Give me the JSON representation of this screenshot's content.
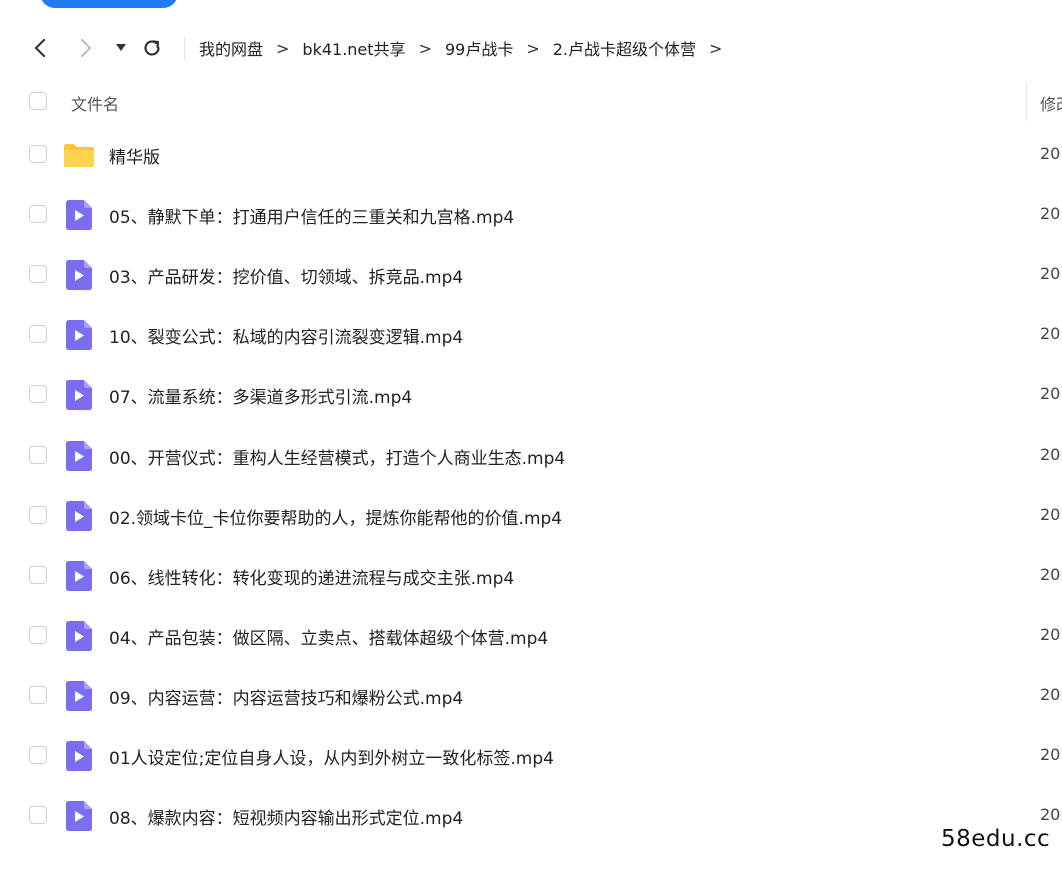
{
  "nav": {
    "breadcrumbs": [
      "我的网盘",
      "bk41.net共享",
      "99卢战卡",
      "2.卢战卡超级个体营"
    ],
    "separator": ">"
  },
  "header": {
    "name_col": "文件名",
    "modified_col": "修改"
  },
  "files": [
    {
      "name": "精华版",
      "type": "folder",
      "date": "20"
    },
    {
      "name": "05、静默下单：打通用户信任的三重关和九宫格.mp4",
      "type": "video",
      "date": "20"
    },
    {
      "name": "03、产品研发：挖价值、切领域、拆竞品.mp4",
      "type": "video",
      "date": "20"
    },
    {
      "name": "10、裂变公式：私域的内容引流裂变逻辑.mp4",
      "type": "video",
      "date": "20"
    },
    {
      "name": "07、流量系统：多渠道多形式引流.mp4",
      "type": "video",
      "date": "20"
    },
    {
      "name": "00、开营仪式：重构人生经营模式，打造个人商业生态.mp4",
      "type": "video",
      "date": "20"
    },
    {
      "name": "02.领域卡位_卡位你要帮助的人，提炼你能帮他的价值.mp4",
      "type": "video",
      "date": "20"
    },
    {
      "name": "06、线性转化：转化变现的递进流程与成交主张.mp4",
      "type": "video",
      "date": "20"
    },
    {
      "name": "04、产品包装：做区隔、立卖点、搭载体超级个体营.mp4",
      "type": "video",
      "date": "20"
    },
    {
      "name": "09、内容运营：内容运营技巧和爆粉公式.mp4",
      "type": "video",
      "date": "20"
    },
    {
      "name": "01人设定位;定位自身人设，从内到外树立一致化标签.mp4",
      "type": "video",
      "date": "20"
    },
    {
      "name": "08、爆款内容：短视频内容输出形式定位.mp4",
      "type": "video",
      "date": "20"
    }
  ],
  "icons": {
    "back": "chevron-left-icon",
    "forward": "chevron-right-icon",
    "history": "caret-down-icon",
    "refresh": "refresh-icon",
    "folder": "folder-icon",
    "video": "video-file-icon"
  },
  "colors": {
    "accent": "#1e7cf3",
    "folder": "#f9c63a",
    "video_icon": "#7b6cf0"
  },
  "watermark": "58edu.cc"
}
